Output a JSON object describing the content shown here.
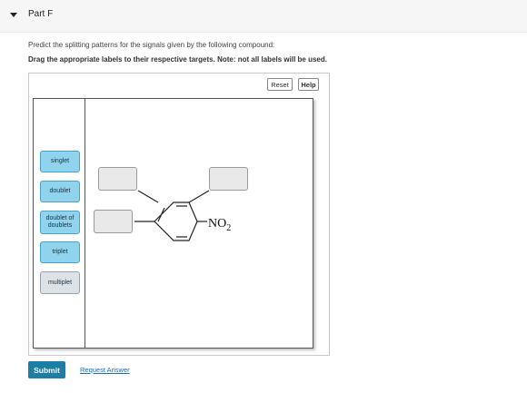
{
  "header": {
    "title": "Part F"
  },
  "instructions": {
    "line1": "Predict the splitting patterns for the signals given by the following compound:",
    "line2": "Drag the appropriate labels to their respective targets. Note: not all labels will be used."
  },
  "toolbar": {
    "reset_label": "Reset",
    "help_label": "Help"
  },
  "labels": [
    "singlet",
    "doublet",
    "doublet of doublets",
    "triplet",
    "multiplet"
  ],
  "molecule": {
    "substituent": "NO",
    "substituent_subscript": "2"
  },
  "footer": {
    "submit_label": "Submit",
    "request_label": "Request Answer"
  },
  "colors": {
    "label_fill": "#8fd3ec",
    "label_fill_selected": "#dde2e6",
    "submit": "#1a7ea5",
    "link": "#1a6fb3"
  }
}
